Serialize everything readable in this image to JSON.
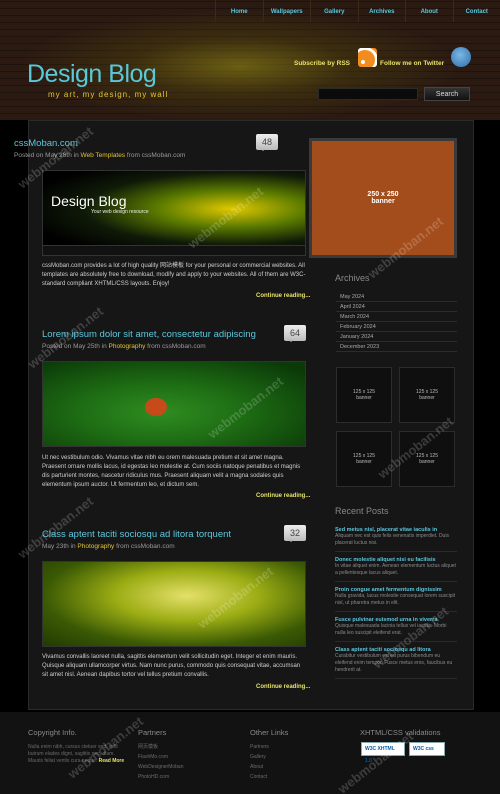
{
  "nav": [
    "Home",
    "Wallpapers",
    "Gallery",
    "Archives",
    "About",
    "Contact"
  ],
  "header": {
    "logo": "Design Blog",
    "tagline": "my art, my design, my wall",
    "subscribe": "Subscribe by RSS",
    "follow": "Follow me on Twitter",
    "search_placeholder": "",
    "search_button": "Search"
  },
  "posts": [
    {
      "title": "cssMoban.com",
      "meta_prefix": "Posted on May 28th in ",
      "category": "Web Templates",
      "meta_suffix": " from cssMoban.com",
      "comments": "48",
      "excerpt": "cssMoban.com provides a lot of high quality 网站模板 for your personal or commercial websites. All templates are absolutely free to download, modify and apply to your websites. All of them are W3C-standard compliant XHTML/CSS layouts. Enjoy!",
      "continue": "Continue reading...",
      "image_logo": "Design Blog",
      "image_sub": "Your web design resource"
    },
    {
      "title": "Lorem ipsum dolor sit amet, consectetur adipiscing",
      "meta_prefix": "Posted on May 25th in ",
      "category": "Photography",
      "meta_suffix": " from cssMoban.com",
      "comments": "64",
      "excerpt": "Ut nec vestibulum odio. Vivamus vitae nibh eu orem malesuada pretium et sit amet magna. Praesent ornare mollis lacus, id egestas leo molestie at. Cum sociis natoque penatibus et magnis dis parturient montes, nascetur ridiculus mus. Praesent aliquam velit a magna sodales quis elementum ipsum auctor. Ut fermentum leo, et dictum sem.",
      "continue": "Continue reading..."
    },
    {
      "title": "Class aptent taciti sociosqu ad litora torquent",
      "meta_prefix": "May 23th in ",
      "category": "Photography",
      "meta_suffix": " from cssMoban.com",
      "comments": "32",
      "excerpt": "Vivamus convallis laoreet nulla, sagittis elementum velit sollicitudin eget. Integer et enim mauris. Quisque aliquam ullamcorper virtus. Nam nunc purus, commodo quis consequat vitae, accumsan sit amet nisl. Aenean dapibus tortor vel tellus pretium convallis.",
      "continue": "Continue reading..."
    }
  ],
  "sidebar": {
    "banner": "250 x 250\nbanner",
    "archives_title": "Archives",
    "archives": [
      "May 2024",
      "April 2024",
      "March 2024",
      "February 2024",
      "January 2024",
      "December 2023"
    ],
    "ads": [
      "125 x 125\nbanner",
      "125 x 125\nbanner",
      "125 x 125\nbanner",
      "125 x 125\nbanner"
    ],
    "recent_title": "Recent Posts",
    "recent": [
      {
        "title": "Sed metus nisl, placerat vitae iaculis in",
        "text": "Aliquam nec est quis felis venenatis imperdiet. Duis placerat luctus nisi."
      },
      {
        "title": "Donec molestie aliquet nisi eu facilisis",
        "text": "In vitae aliquet enim. Aenean elementum luctus aliquet a pellentesque lacus aliquet."
      },
      {
        "title": "Proin congue amet fermentum dignissim",
        "text": "Nulla gravida, lacus molestie consequat lorem suscipit nisl, ut pharetra metus in elit."
      },
      {
        "title": "Fusce pulvinar euismod urna in viverra",
        "text": "Quisque malesuada lacinia tellus vel iaculis. Morbi nulla leo suscipit eleifend erat."
      },
      {
        "title": "Class aptent taciti sociosqu ad litora",
        "text": "Curabitur vestibulum est eu purus bibendum eu eleifend enim tempor. Fusce metus eros, faucibus eu hendrerit at."
      }
    ]
  },
  "footer": {
    "copyright_title": "Copyright Info.",
    "copyright_text": "Nulla enim nibh, cursus ctetuer sed, velit butrum elades dignt, sagittis nec, diam. Mauris feliat ventis cura neque.",
    "read_more": "Read More",
    "partners_title": "Partners",
    "partners": [
      "网页模板",
      "FlashMo.com",
      "WebDesignerMoban",
      "PhotoHD.com"
    ],
    "other_title": "Other Links",
    "other": [
      "Partners",
      "Gallery",
      "About",
      "Contact"
    ],
    "validation_title": "XHTML/CSS validations",
    "badge_xhtml": "W3C XHTML 1.0",
    "badge_css": "W3C css"
  },
  "watermark": "webmoban.net"
}
